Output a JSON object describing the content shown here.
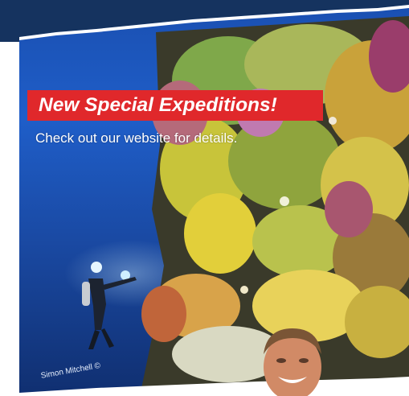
{
  "promo": {
    "headline": "New Special Expeditions!",
    "subline": "Check out our website for details.",
    "credit": "Simon Mitchell ©"
  },
  "colors": {
    "headline_bg": "#e0282b",
    "ocean_top": "#1a4fb0",
    "ocean_bottom": "#102f70",
    "band": "#15335f"
  },
  "images": {
    "background": "underwater reef wall with soft corals and diver",
    "portrait": "smiling man face"
  }
}
